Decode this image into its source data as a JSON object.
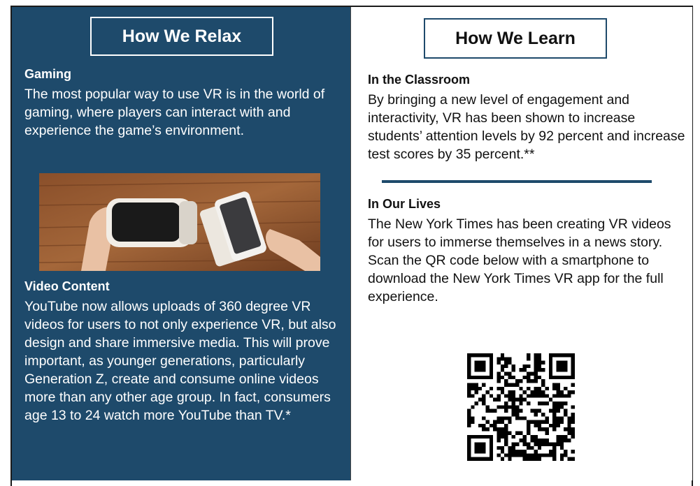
{
  "left_panel": {
    "title": "How We Relax",
    "gaming_heading": "Gaming",
    "gaming_text": "The most popular way to use VR is in the world of gaming, where players can interact with and experience the game’s environment.",
    "photo_icon": "vr-headset-and-phone-photo",
    "video_heading": "Video Content",
    "video_text": "YouTube now allows uploads of 360 degree VR videos for users to not only experience VR, but also design and share immersive media. This will prove important, as younger generations, particularly Generation Z, create and consume online videos more than any other age group. In fact, consumers age 13 to 24 watch more YouTube than TV.*"
  },
  "right_panel": {
    "title": "How We Learn",
    "classroom_heading": "In the Classroom",
    "classroom_text": "By bringing a new level of engagement and interactivity, VR has been shown to increase students’ attention levels by 92 percent and increase test scores by 35 percent.**",
    "lives_heading": "In Our Lives",
    "lives_text": "The New York Times has been creating VR videos for users to immerse themselves in a news story. Scan the QR code below with a smartphone to download the New York Times VR app for the full experience.",
    "qr_icon": "qr-code"
  },
  "colors": {
    "left_bg": "#1e4a6b",
    "accent": "#1e4a6b",
    "text_dark": "#111111",
    "text_light": "#ffffff"
  }
}
